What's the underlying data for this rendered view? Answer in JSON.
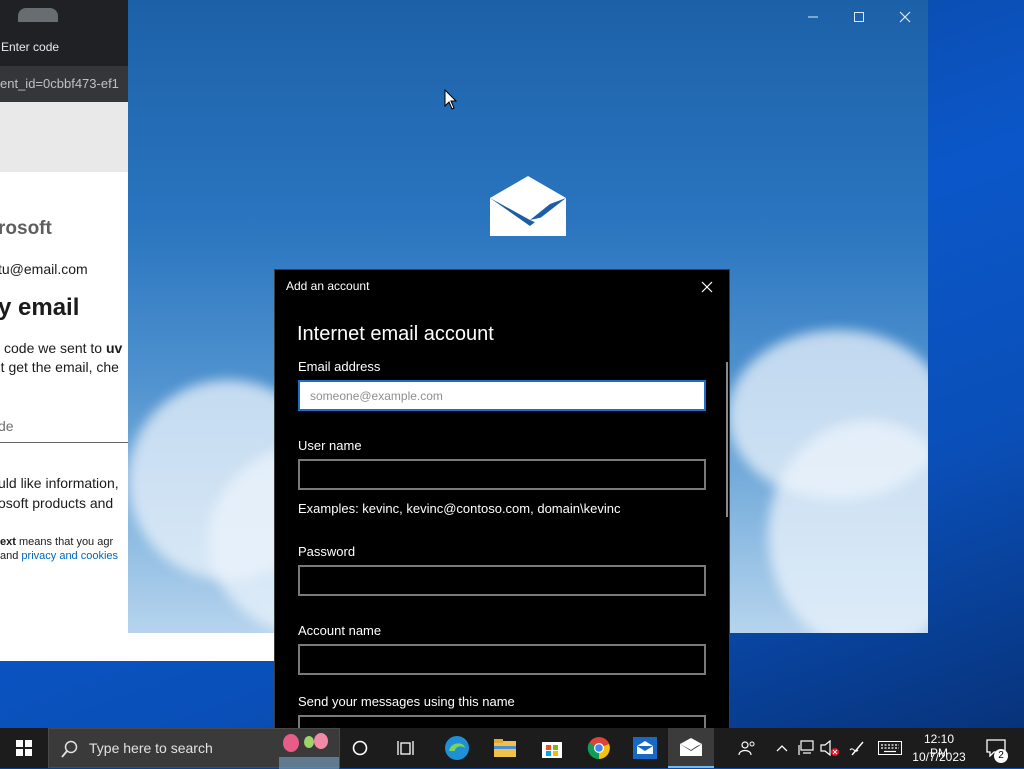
{
  "browser": {
    "tab_title": "Enter code",
    "url_fragment": "ent_id=0cbbf473-ef1",
    "brand": "rosoft",
    "email": "tu@email.com",
    "heading": "y email",
    "line1_prefix": "code we sent to ",
    "line1_bold": "uv",
    "line2": "'t get the email, che",
    "code_placeholder": "de",
    "info_line1": "uld like information,",
    "info_line2": "osoft products and",
    "terms_bold": "ext",
    "terms_rest": " means that you agr",
    "terms2_prefix": "and ",
    "terms2_link": "privacy and cookies"
  },
  "mail_window": {
    "controls": [
      "minimize-icon",
      "maximize-icon",
      "close-icon"
    ]
  },
  "dialog": {
    "title": "Add an account",
    "heading": "Internet email account",
    "fields": {
      "email": {
        "label": "Email address",
        "placeholder": "someone@example.com",
        "value": ""
      },
      "username": {
        "label": "User name",
        "value": "",
        "hint": "Examples: kevinc, kevinc@contoso.com, domain\\kevinc"
      },
      "password": {
        "label": "Password",
        "value": ""
      },
      "account_name": {
        "label": "Account name",
        "value": ""
      },
      "send_name": {
        "label": "Send your messages using this name",
        "value": ""
      }
    }
  },
  "taskbar": {
    "search_placeholder": "Type here to search",
    "time": "12:10 PM",
    "date": "10/7/2023",
    "notification_count": "2",
    "apps": [
      "cortana-icon",
      "task-view-icon",
      "edge-icon",
      "file-explorer-icon",
      "store-icon",
      "chrome-icon",
      "app-icon",
      "mail-icon"
    ],
    "accent_color": "#76b9ed"
  }
}
